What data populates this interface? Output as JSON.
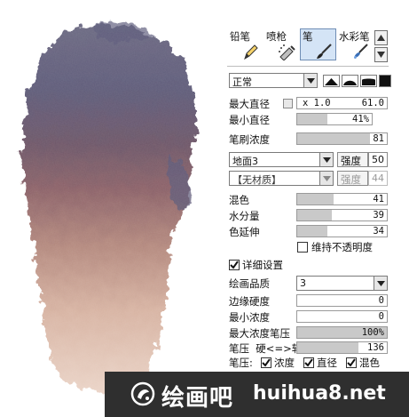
{
  "brush_tabs": [
    {
      "label": "铅笔",
      "icon": "pencil-icon"
    },
    {
      "label": "喷枪",
      "icon": "airbrush-icon"
    },
    {
      "label": "笔",
      "icon": "brush-icon",
      "active": true
    },
    {
      "label": "水彩笔",
      "icon": "watercolor-icon"
    }
  ],
  "blend_mode": {
    "value": "正常"
  },
  "max_diameter": {
    "label": "最大直径",
    "multiplier": "x 1.0",
    "value": "61.0"
  },
  "min_diameter": {
    "label": "最小直径",
    "value": "41%",
    "fraction": 0.41
  },
  "brush_density": {
    "label": "笔刷浓度",
    "value": "81",
    "fraction": 0.81
  },
  "paper_texture": {
    "value": "地面3",
    "strength_label": "强度",
    "strength_value": "50"
  },
  "material": {
    "value": "【无材质】",
    "strength_label": "强度",
    "strength_value": "44"
  },
  "blending": {
    "label": "混色",
    "value": "41",
    "fraction": 0.41
  },
  "water_amount": {
    "label": "水分量",
    "value": "39",
    "fraction": 0.39
  },
  "color_extension": {
    "label": "色延伸",
    "value": "34",
    "fraction": 0.34
  },
  "keep_opacity": {
    "label": "维持不透明度",
    "checked": false
  },
  "detail_settings": {
    "label": "详细设置",
    "checked": true
  },
  "quality": {
    "label": "绘画品质",
    "value": "3"
  },
  "edge_hardness": {
    "label": "边缘硬度",
    "value": "0",
    "fraction": 0.0
  },
  "min_density": {
    "label": "最小浓度",
    "value": "0",
    "fraction": 0.0
  },
  "max_density_pressure": {
    "label": "最大浓度笔压",
    "value": "100%",
    "fraction": 1.0
  },
  "pressure_hardness": {
    "label": "笔压  硬<=>软",
    "value": "136",
    "fraction": 0.68
  },
  "pressure_flags": {
    "label": "笔压:",
    "items": [
      {
        "label": "浓度",
        "checked": true
      },
      {
        "label": "直径",
        "checked": true
      },
      {
        "label": "混色",
        "checked": true
      }
    ]
  },
  "watermark": {
    "chinese": "绘画吧",
    "url": "huihua8.net"
  },
  "colors": {
    "panel_accent": "#d4e4f6",
    "stroke_top": "#5c5a78",
    "stroke_mid": "#8a6470",
    "stroke_bottom": "#e2c2b2"
  }
}
